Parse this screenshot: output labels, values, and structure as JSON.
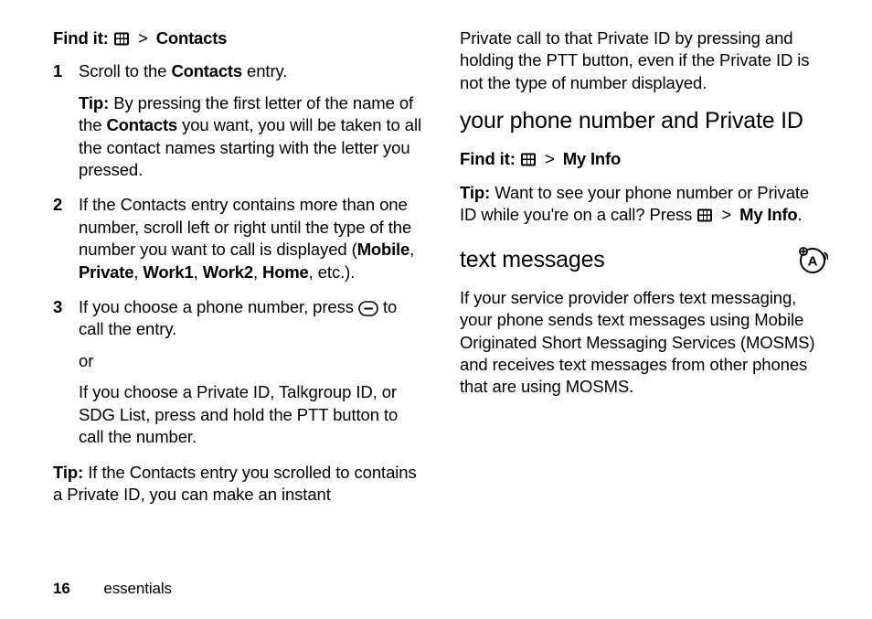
{
  "col1": {
    "find_it_label": "Find it:",
    "find_it_target": "Contacts",
    "steps": [
      {
        "num": "1",
        "pre": "Scroll to the ",
        "bold1": "Contacts",
        "post": " entry.",
        "tip_label": "Tip:",
        "tip_pre": " By pressing the first letter of the name of the ",
        "tip_bold": "Contacts",
        "tip_post": " you want, you will be taken to all the contact names starting with the letter you pressed."
      },
      {
        "num": "2",
        "pre": "If the Contacts entry contains more than one number, scroll left or right until the type of the number you want to call is displayed (",
        "b1": "Mobile",
        "b2": "Private",
        "b3": "Work1",
        "b4": "Work2",
        "b5": "Home",
        "post": ", etc.)."
      },
      {
        "num": "3",
        "pre": "If you choose a phone number, press ",
        "post": " to call the entry.",
        "or_text": "or",
        "alt_text": "If you choose a Private ID, Talkgroup ID, or SDG List, press and hold the PTT button to call the number."
      }
    ],
    "bottom_tip_label": "Tip:",
    "bottom_tip_text": " If the Contacts entry you scrolled to contains a Private ID, you can make an instant"
  },
  "col2": {
    "cont_text": "Private call to that Private ID by pressing and holding the PTT button, even if the Private ID is not the type of number displayed.",
    "section1_title": "your phone number and Private ID",
    "find_it_label": "Find it:",
    "find_it_target": "My Info",
    "tip_label": "Tip:",
    "tip_pre": " Want to see your phone number or Private ID while you're on a call? Press ",
    "tip_bold": "My Info",
    "tip_post": ".",
    "section2_title": "text messages",
    "section2_body": "If your service provider offers text messaging, your phone sends text messages using Mobile Originated Short Messaging Services (MOSMS) and receives text messages from other phones that are using MOSMS."
  },
  "footer": {
    "page_num": "16",
    "section": "essentials"
  }
}
